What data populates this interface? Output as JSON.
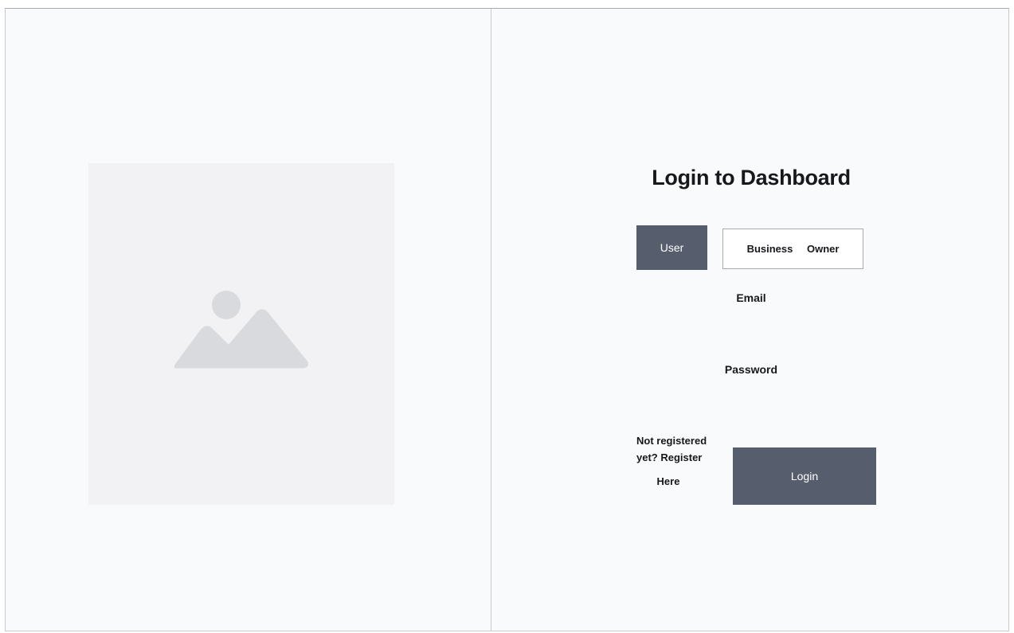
{
  "left": {
    "image_icon": "image-placeholder-icon"
  },
  "login": {
    "title": "Login to Dashboard",
    "tabs": {
      "user_label": "User",
      "business_owner_label": "Business Owner"
    },
    "email_label": "Email",
    "email_value": "",
    "password_label": "Password",
    "password_value": "",
    "register_line1": "Not registered",
    "register_line2": "yet? Register",
    "register_line3": "Here",
    "login_button_label": "Login"
  },
  "colors": {
    "background": "#f8fafc",
    "accent": "#565d6c",
    "placeholder": "#f2f2f4",
    "placeholder_icon": "#d9dade"
  }
}
